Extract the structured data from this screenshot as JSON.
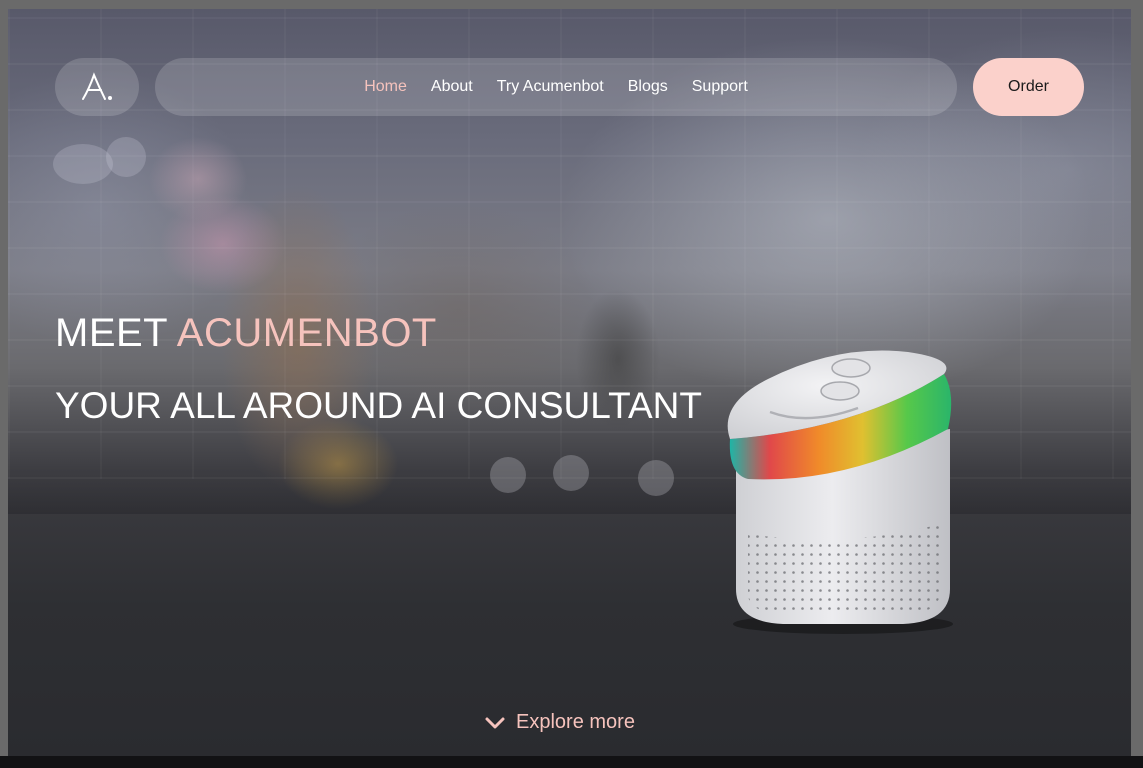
{
  "brand": {
    "logo_text": "A."
  },
  "nav": {
    "links": [
      {
        "label": "Home",
        "active": true
      },
      {
        "label": "About",
        "active": false
      },
      {
        "label": "Try Acumenbot",
        "active": false
      },
      {
        "label": "Blogs",
        "active": false
      },
      {
        "label": "Support",
        "active": false
      }
    ],
    "order_label": "Order"
  },
  "hero": {
    "line1_prefix": "MEET ",
    "line1_accent": "ACUMENBOT",
    "line2": "YOUR ALL AROUND AI CONSULTANT"
  },
  "explore": {
    "label": "Explore more",
    "icon": "chevron-down-icon"
  },
  "colors": {
    "accent": "#f6c3bd",
    "order_button_bg": "#fbd1cb",
    "text": "#ffffff"
  }
}
